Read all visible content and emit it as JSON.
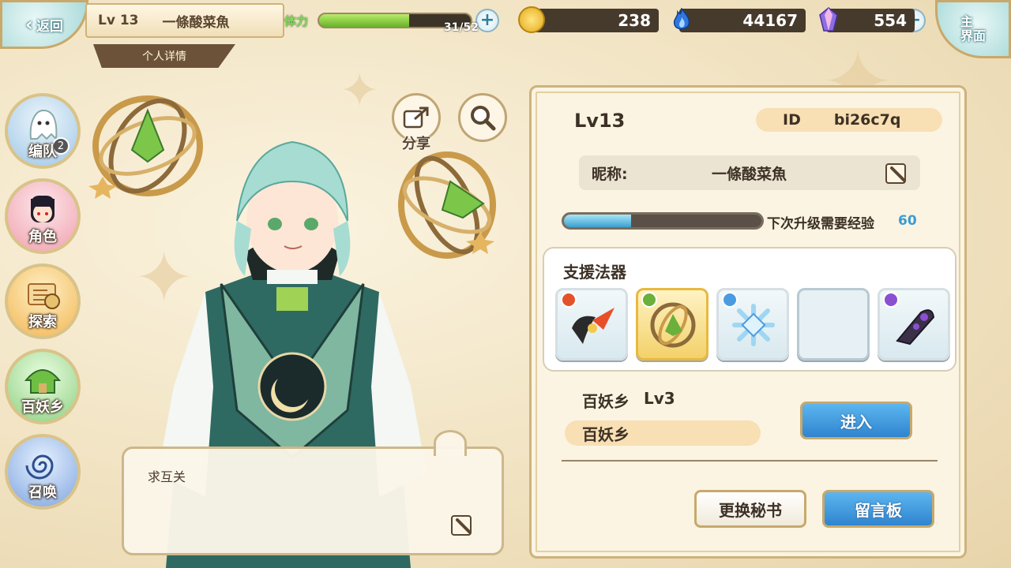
{
  "header": {
    "back_label": "返回",
    "player_level": "Lv 13",
    "player_name": "一條酸菜魚",
    "subtitle": "个人详情",
    "home_label_1": "主",
    "home_label_2": "界面"
  },
  "resources": {
    "stamina_label": "体力",
    "stamina_value": "31/52",
    "stamina_fraction": 0.596,
    "gold": "238",
    "flame": "44167",
    "crystal": "554",
    "plus": "+"
  },
  "sidenav": {
    "items": [
      {
        "label": "编队",
        "badge": "2"
      },
      {
        "label": "角色"
      },
      {
        "label": "探索"
      },
      {
        "label": "百妖乡"
      },
      {
        "label": "召唤"
      }
    ]
  },
  "character": {
    "share_label": "分享",
    "message": "求互关"
  },
  "profile": {
    "level": "Lv13",
    "id_label": "ID",
    "id_value": "bi26c7q",
    "nickname_label": "昵称:",
    "nickname_value": "一條酸菜魚",
    "exp_label": "下次升级需要经验",
    "exp_value": "60",
    "exp_fraction": 0.34,
    "support_title": "支援法器",
    "slots": [
      {
        "element_color": "#e2532a",
        "icon": "sword-artifact"
      },
      {
        "element_color": "#6ab03a",
        "icon": "armillary-artifact"
      },
      {
        "element_color": "#4b9be0",
        "icon": "crystal-lattice-artifact"
      },
      {
        "element_color": "",
        "icon": "empty"
      },
      {
        "element_color": "#8b4fd1",
        "icon": "dark-blade-artifact"
      }
    ],
    "village_name": "百妖乡",
    "village_level": "Lv3",
    "village_box": "百妖乡",
    "enter_label": "进入",
    "change_secretary_label": "更换秘书",
    "message_board_label": "留言板"
  }
}
